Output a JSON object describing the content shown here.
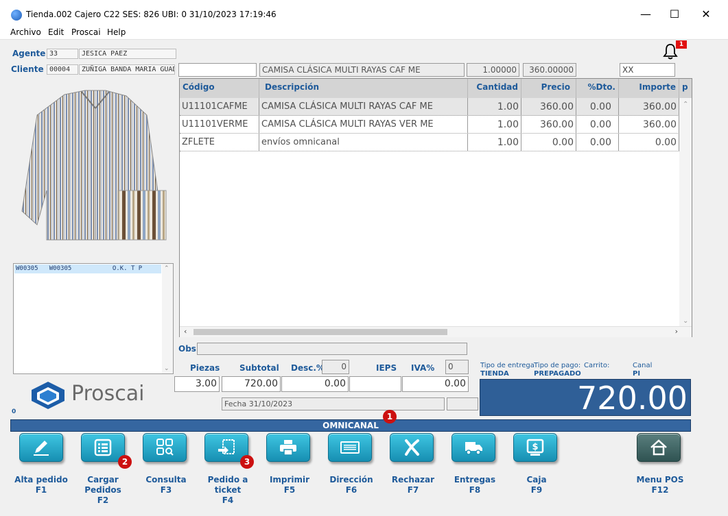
{
  "window": {
    "title": "Tienda.002  Cajero C22    SES: 826  UBI: 0  31/10/2023 17:19:46",
    "minimize_glyph": "—",
    "maximize_glyph": "☐",
    "close_glyph": "✕"
  },
  "menu": [
    "Archivo",
    "Edit",
    "Proscai",
    "Help"
  ],
  "notification": {
    "icon": "bell-icon",
    "count": "1"
  },
  "agente": {
    "label": "Agente",
    "code": "33",
    "name": "JESICA PAEZ"
  },
  "cliente": {
    "label": "Cliente",
    "code": "00004",
    "name": "ZUÑIGA BANDA MARIA GUAD"
  },
  "entry": {
    "code": "",
    "description": "CAMISA CLÁSICA MULTI RAYAS CAF ME",
    "quantity": "1.00000",
    "price": "360.00000",
    "extra": "XX"
  },
  "grid": {
    "columns": [
      "Código",
      "Descripción",
      "Cantidad",
      "Precio",
      "%Dto.",
      "Importe",
      "p"
    ],
    "rows": [
      {
        "codigo": "U11101CAFME",
        "descripcion": "CAMISA CLÁSICA MULTI RAYAS CAF ME",
        "cantidad": "1.00",
        "precio": "360.00",
        "dto": "0.00",
        "importe": "360.00"
      },
      {
        "codigo": "U11101VERME",
        "descripcion": "CAMISA CLÁSICA MULTI RAYAS VER ME",
        "cantidad": "1.00",
        "precio": "360.00",
        "dto": "0.00",
        "importe": "360.00"
      },
      {
        "codigo": "ZFLETE",
        "descripcion": "envíos omnicanal",
        "cantidad": "1.00",
        "precio": "0.00",
        "dto": "0.00",
        "importe": "0.00"
      }
    ]
  },
  "listbox": {
    "item": "W00305   W00305           O.K. T P"
  },
  "obs": {
    "label": "Obs",
    "value": ""
  },
  "totals": {
    "piezas_label": "Piezas",
    "piezas": "3.00",
    "subtotal_label": "Subtotal",
    "subtotal": "720.00",
    "desc_label": "Desc.%",
    "desc_pct": "0",
    "desc": "0.00",
    "ieps_label": "IEPS",
    "ieps": "",
    "iva_label": "IVA%",
    "iva_pct": "0",
    "iva": "0.00",
    "fecha": "Fecha 31/10/2023"
  },
  "delivery": {
    "tipo_entrega_label": "Tipo de entrega",
    "tipo_entrega": "TIENDA",
    "tipo_pago_label": "Tipo de pago:",
    "tipo_pago": "PREPAGADO",
    "carrito_label": "Carrito:",
    "canal_label": "Canal",
    "canal": "PI"
  },
  "grand_total": "720.00",
  "logo_text": "Proscai",
  "footer_zero": "0",
  "band": {
    "label": "OMNICANAL",
    "badge": "1"
  },
  "buttons": [
    {
      "label": "Alta pedido",
      "key": "F1",
      "icon": "pencil-icon"
    },
    {
      "label": "Cargar Pedidos",
      "key": "F2",
      "icon": "list-icon",
      "badge": "2"
    },
    {
      "label": "Consulta",
      "key": "F3",
      "icon": "search-grid-icon"
    },
    {
      "label": "Pedido a ticket",
      "key": "F4",
      "icon": "ticket-transfer-icon",
      "badge": "3"
    },
    {
      "label": "Imprimir",
      "key": "F5",
      "icon": "printer-icon"
    },
    {
      "label": "Dirección",
      "key": "F6",
      "icon": "address-card-icon"
    },
    {
      "label": "Rechazar",
      "key": "F7",
      "icon": "reject-x-icon"
    },
    {
      "label": "Entregas",
      "key": "F8",
      "icon": "delivery-truck-icon"
    },
    {
      "label": "Caja",
      "key": "F9",
      "icon": "cash-register-icon"
    },
    {
      "label": "Menu POS",
      "key": "F12",
      "icon": "home-icon"
    }
  ],
  "colors": {
    "accent": "#1e5a9a",
    "button": "#2fb4d4",
    "total_bg": "#2f5f97",
    "badge": "#cc1010"
  }
}
